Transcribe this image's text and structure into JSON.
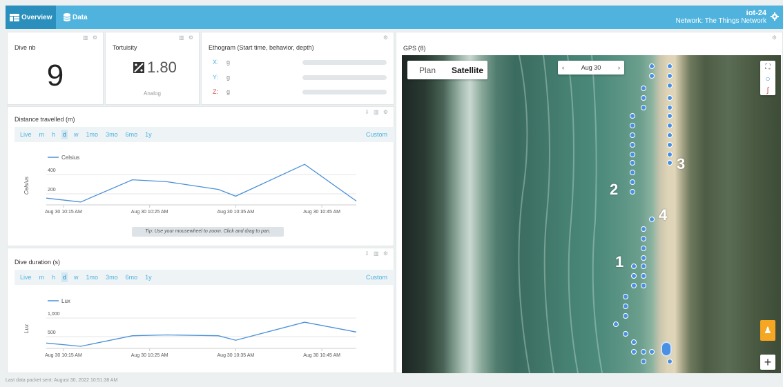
{
  "header": {
    "tabs": [
      {
        "label": "Overview",
        "icon": "dashboard-icon"
      },
      {
        "label": "Data",
        "icon": "database-icon"
      }
    ],
    "device_name": "iot-24",
    "network": "Network: The Things Network"
  },
  "dive_nb": {
    "title": "Dive nb",
    "value": "9"
  },
  "tortuosity": {
    "title": "Tortuisity",
    "value": "1.80",
    "subtitle": "Analog"
  },
  "ethogram": {
    "title": "Ethogram (Start time, behavior, depth)",
    "rows": [
      {
        "axis": "X:",
        "unit": "g",
        "color": "#4fb3de"
      },
      {
        "axis": "Y:",
        "unit": "g",
        "color": "#4fb3de"
      },
      {
        "axis": "Z:",
        "unit": "g",
        "color": "#d9534f"
      }
    ]
  },
  "ranges": [
    "Live",
    "m",
    "h",
    "d",
    "w",
    "1mo",
    "3mo",
    "6mo",
    "1y"
  ],
  "selected_range": "d",
  "custom_label": "Custom",
  "distance": {
    "title": "Distance travelled (m)",
    "tip": "Tip: Use your mousewheel to zoom. Click and drag to pan."
  },
  "duration": {
    "title": "Dive duration (s)"
  },
  "gps": {
    "title": "GPS (8)",
    "plan_label": "Plan",
    "satellite_label": "Satellite",
    "date_label": "Aug 30",
    "labels": [
      "1",
      "2",
      "3",
      "4"
    ]
  },
  "footer": "Last data packet sent: August 30, 2022 10:51:38 AM",
  "chart_data": [
    {
      "type": "line",
      "series": [
        {
          "name": "Celsius",
          "x": [
            "10:13",
            "10:17",
            "10:23",
            "10:27",
            "10:33",
            "10:35",
            "10:43",
            "10:49"
          ],
          "values": [
            70,
            30,
            260,
            240,
            160,
            90,
            420,
            40
          ]
        }
      ],
      "xticks": [
        "Aug 30 10:15 AM",
        "Aug 30 10:25 AM",
        "Aug 30 10:35 AM",
        "Aug 30 10:45 AM"
      ],
      "ylabel": "Celsius",
      "yticks": [
        "400",
        "200"
      ],
      "ylim": [
        0,
        500
      ],
      "color": "#4a90d9"
    },
    {
      "type": "line",
      "series": [
        {
          "name": "Lux",
          "x": [
            "10:13",
            "10:17",
            "10:23",
            "10:27",
            "10:33",
            "10:35",
            "10:43",
            "10:49"
          ],
          "values": [
            130,
            50,
            310,
            330,
            310,
            200,
            640,
            400
          ]
        }
      ],
      "xticks": [
        "Aug 30 10:15 AM",
        "Aug 30 10:25 AM",
        "Aug 30 10:35 AM",
        "Aug 30 10:45 AM"
      ],
      "ylabel": "Lux",
      "yticks": [
        "1,000",
        "500"
      ],
      "ylim": [
        0,
        1200
      ],
      "color": "#4a90d9"
    }
  ]
}
